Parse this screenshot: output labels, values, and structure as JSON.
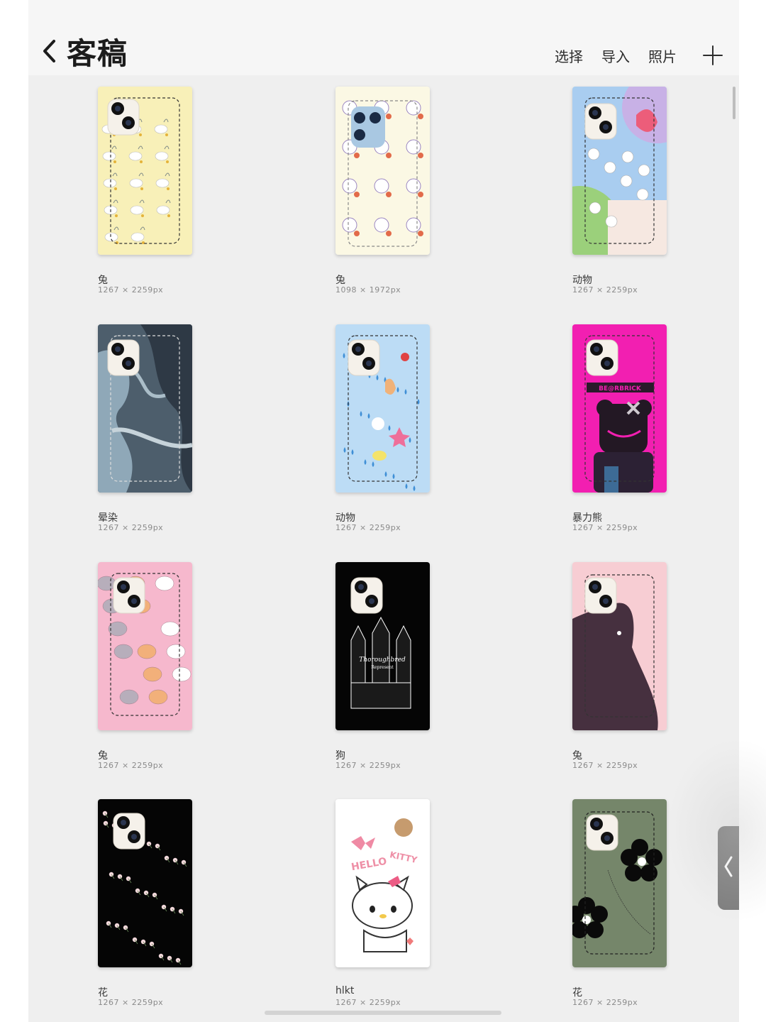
{
  "header": {
    "title": "客稿",
    "actions": [
      {
        "label": "选择"
      },
      {
        "label": "导入"
      },
      {
        "label": "照片"
      }
    ]
  },
  "items": [
    {
      "name": "兔",
      "size": "1267 × 2259px",
      "bg": "#f8f0b8",
      "theme": "bunny-yellow"
    },
    {
      "name": "兔",
      "size": "1098 × 1972px",
      "bg": "#fbf8e4",
      "theme": "bunny-cream"
    },
    {
      "name": "动物",
      "size": "1267 × 2259px",
      "bg": "#a9cdf0",
      "theme": "animal-pastel"
    },
    {
      "name": "晕染",
      "size": "1267 × 2259px",
      "bg": "#5f7585",
      "theme": "marble-blue"
    },
    {
      "name": "动物",
      "size": "1267 × 2259px",
      "bg": "#bcdcf5",
      "theme": "animal-rain"
    },
    {
      "name": "暴力熊",
      "size": "1267 × 2259px",
      "bg": "#f21fb1",
      "theme": "bearbrick"
    },
    {
      "name": "兔",
      "size": "1267 × 2259px",
      "bg": "#f6b8cd",
      "theme": "bunny-pink"
    },
    {
      "name": "狗",
      "size": "1267 × 2259px",
      "bg": "#050505",
      "theme": "dogs-black"
    },
    {
      "name": "兔",
      "size": "1267 × 2259px",
      "bg": "#f7cdd3",
      "theme": "rabbit-silhouette"
    },
    {
      "name": "花",
      "size": "1267 × 2259px",
      "bg": "#050505",
      "theme": "flowers-black"
    },
    {
      "name": "hlkt",
      "size": "1267 × 2259px",
      "bg": "#ffffff",
      "theme": "hello-kitty"
    },
    {
      "name": "花",
      "size": "1267 × 2259px",
      "bg": "#75866a",
      "theme": "flowers-green"
    }
  ]
}
